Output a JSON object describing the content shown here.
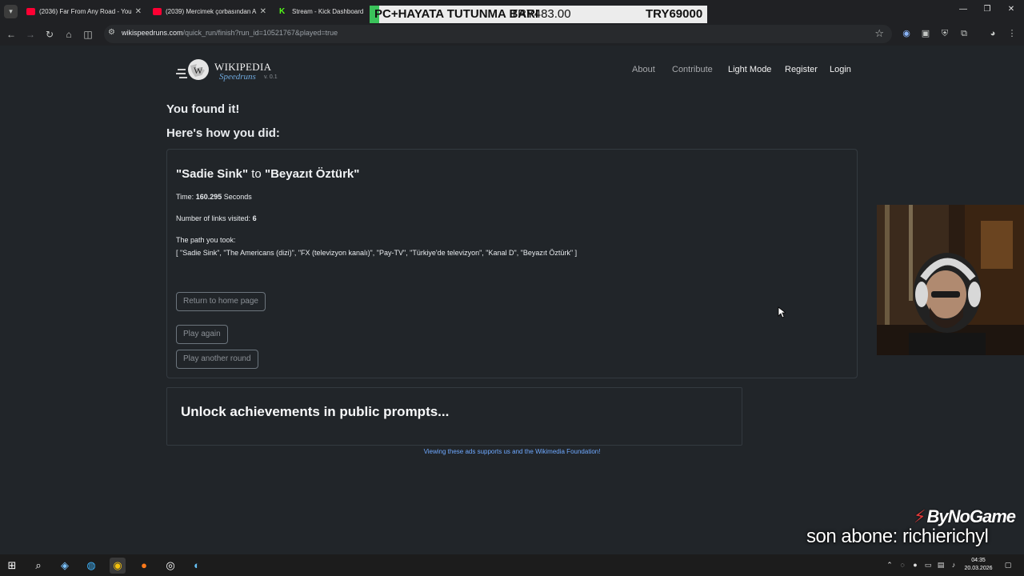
{
  "browser": {
    "tabs": [
      {
        "title": "(2036) Far From Any Road - You",
        "favicon": "youtube-icon"
      },
      {
        "title": "(2039) Mercimek çorbasından A",
        "favicon": "youtube-icon"
      },
      {
        "title": "Stream - Kick Dashboard",
        "favicon": "kick-icon"
      }
    ],
    "donation_banner": {
      "text": "PC+HAYATA TUTUNMA BARI",
      "amount_current": "TRY483.00",
      "amount_goal": "TRY69000"
    },
    "url_host": "wikispeedruns.com",
    "url_path": "/quick_run/finish?run_id=10521767&played=true"
  },
  "site": {
    "logo_wordmark": "WIKIPEDIA",
    "logo_subtitle": "Speedruns",
    "version": "v. 0.1",
    "nav": {
      "about": "About",
      "contribute": "Contribute",
      "light_mode": "Light Mode",
      "register": "Register",
      "login": "Login"
    }
  },
  "result": {
    "heading": "You found it!",
    "subheading": "Here's how you did:",
    "start": "\"Sadie Sink\"",
    "to_word": "to",
    "end": "\"Beyazıt Öztürk\"",
    "time_label": "Time:",
    "time_value": "160.295",
    "time_unit": "Seconds",
    "links_label": "Number of links visited:",
    "links_value": "6",
    "path_label": "The path you took:",
    "path_text": "[ \"Sadie Sink\", \"The Americans (dizi)\", \"FX (televizyon kanalı)\", \"Pay-TV\", \"Türkiye'de televizyon\", \"Kanal D\", \"Beyazıt Öztürk\" ]",
    "buttons": {
      "home": "Return to home page",
      "again": "Play again",
      "another": "Play another round"
    }
  },
  "promo": {
    "text": "Unlock achievements in public prompts...",
    "ad_note": "Viewing these ads supports us and the Wikimedia Foundation!"
  },
  "overlay": {
    "brand": "ByNoGame",
    "last_sub": "son abone: richierichyl"
  },
  "taskbar": {
    "time": "04:35",
    "date": "20.03.2026"
  }
}
